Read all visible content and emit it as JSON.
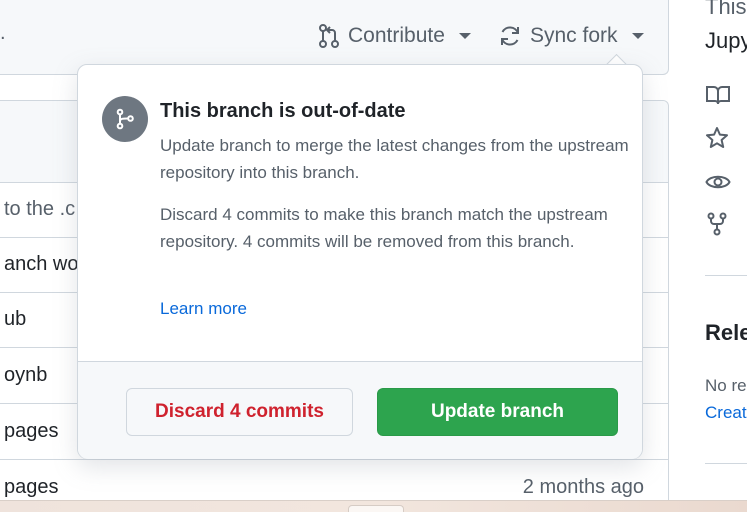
{
  "header": {
    "left_fragment": ".",
    "contribute_label": "Contribute",
    "sync_fork_label": "Sync fork"
  },
  "file_table": {
    "rows": [
      {
        "text": "to the .c",
        "time": ""
      },
      {
        "text": "anch wo",
        "time": ""
      },
      {
        "text": "ub",
        "time": ""
      },
      {
        "text": "oynb",
        "time": ""
      },
      {
        "text": "pages",
        "time": ""
      },
      {
        "text": "pages",
        "time": "2 months ago"
      }
    ]
  },
  "sidebar": {
    "about_line1": "This",
    "about_line2": "Jupy",
    "icons": [
      "book-icon",
      "star-icon",
      "eye-icon",
      "fork-icon"
    ],
    "releases_title": "Rele",
    "no_releases": "No re",
    "create_link": "Creat"
  },
  "popover": {
    "icon": "git-branch-icon",
    "title": "This branch is out-of-date",
    "update_text": "Update branch to merge the latest changes from the upstream repository into this branch.",
    "discard_text": "Discard 4 commits to make this branch match the upstream repository. 4 commits will be removed from this branch.",
    "learn_more": "Learn more",
    "discard_button": "Discard 4 commits",
    "update_button": "Update branch"
  },
  "colors": {
    "danger": "#cf222e",
    "success": "#2da44e",
    "link": "#0969da",
    "muted_text": "#57606a"
  }
}
